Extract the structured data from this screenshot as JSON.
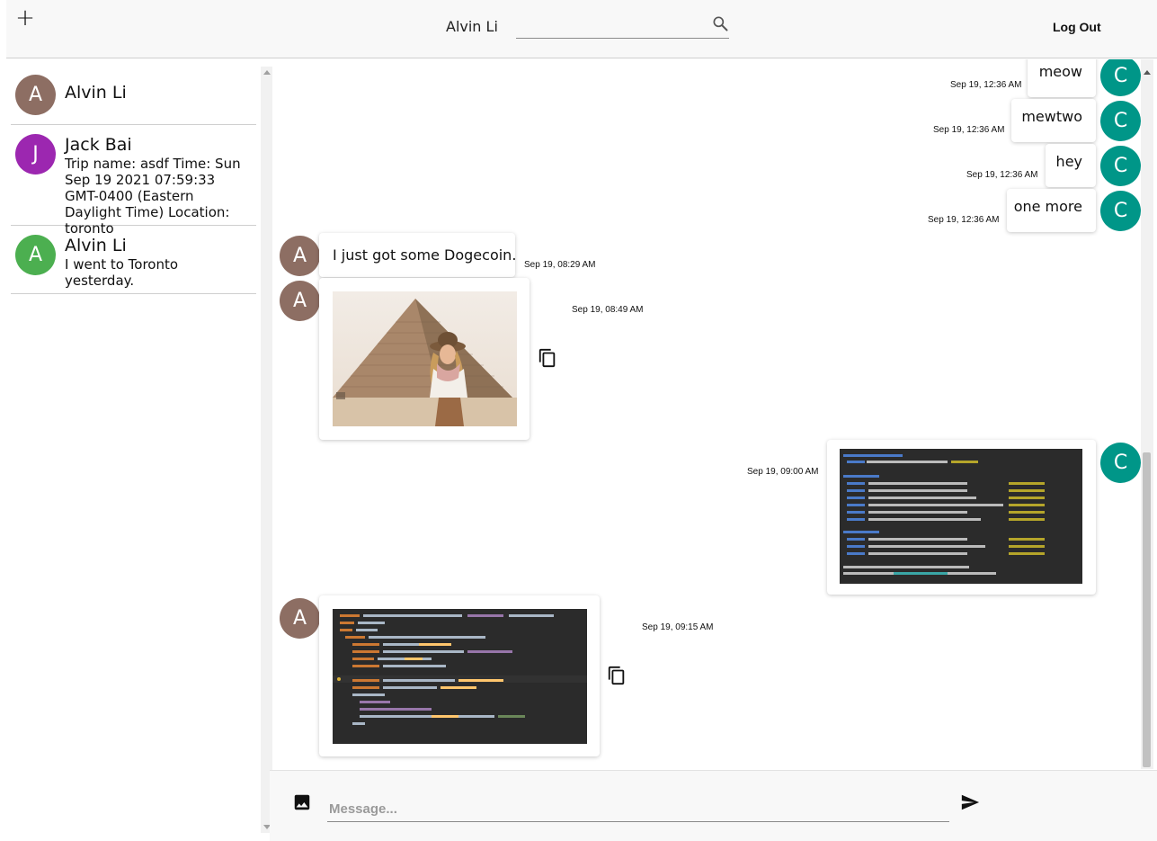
{
  "header": {
    "add_label": "+",
    "user_name": "Alvin Li",
    "search_placeholder": "",
    "logout_label": "Log Out"
  },
  "sidebar": {
    "conversations": [
      {
        "initial": "A",
        "name": "Alvin Li",
        "preview": "",
        "avatar_color": "#8d6e63"
      },
      {
        "initial": "J",
        "name": "Jack Bai",
        "preview": "Trip name: asdf Time: Sun Sep 19 2021 07:59:33 GMT-0400 (Eastern Daylight Time) Location: toronto",
        "avatar_color": "#9c27b0"
      },
      {
        "initial": "A",
        "name": "Alvin Li",
        "preview": "I went to Toronto yesterday.",
        "avatar_color": "#4caf50"
      }
    ]
  },
  "chat": {
    "messages": [
      {
        "sender_initial": "C",
        "text": "meow",
        "time": "Sep 19, 12:36 AM"
      },
      {
        "sender_initial": "C",
        "text": "mewtwo",
        "time": "Sep 19, 12:36 AM"
      },
      {
        "sender_initial": "C",
        "text": "hey",
        "time": "Sep 19, 12:36 AM"
      },
      {
        "sender_initial": "C",
        "text": "one more",
        "time": "Sep 19, 12:36 AM"
      },
      {
        "sender_initial": "A",
        "text": "I just got some Dogecoin.",
        "time": "Sep 19, 08:29 AM"
      },
      {
        "sender_initial": "A",
        "text": "",
        "time": "Sep 19, 08:49 AM",
        "kind": "photo"
      },
      {
        "sender_initial": "C",
        "text": "",
        "time": "Sep 19, 09:00 AM",
        "kind": "screenshot"
      },
      {
        "sender_initial": "A",
        "text": "",
        "time": "Sep 19, 09:15 AM",
        "kind": "screenshot"
      }
    ],
    "colors": {
      "self_avatar": "#009688",
      "other_avatar": "#8d6e63"
    }
  },
  "composer": {
    "placeholder": "Message..."
  },
  "icons": [
    "plus-icon",
    "search-icon",
    "image-icon",
    "send-icon",
    "copy-icon"
  ]
}
